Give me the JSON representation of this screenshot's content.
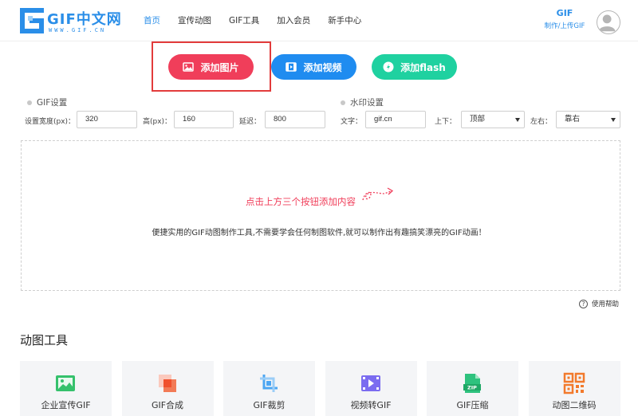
{
  "logo": {
    "title": "GIF中文网",
    "subtitle": "WWW.GIF.CN"
  },
  "nav": {
    "items": [
      {
        "label": "首页",
        "active": true
      },
      {
        "label": "宣传动图",
        "active": false
      },
      {
        "label": "GIF工具",
        "active": false
      },
      {
        "label": "加入会员",
        "active": false
      },
      {
        "label": "新手中心",
        "active": false
      }
    ]
  },
  "header_right": {
    "gif_label": "GIF",
    "gif_sub": "制作/上传GIF"
  },
  "actions": {
    "add_image": "添加图片",
    "add_video": "添加视频",
    "add_flash": "添加flash"
  },
  "gif_settings": {
    "title": "GIF设置",
    "width_label": "设置宽度(px)：",
    "width_value": "320",
    "height_label": "高(px)：",
    "height_value": "160",
    "delay_label": "延迟：",
    "delay_value": "800"
  },
  "watermark": {
    "title": "水印设置",
    "text_label": "文字：",
    "text_value": "gif.cn",
    "vertical_label": "上下：",
    "vertical_value": "顶部",
    "horizontal_label": "左右：",
    "horizontal_value": "靠右"
  },
  "drop_area": {
    "hint": "点击上方三个按钮添加内容",
    "description": "便捷实用的GIF动图制作工具,不需要学会任何制图软件,就可以制作出有趣搞笑漂亮的GIF动画！"
  },
  "help": {
    "label": "使用帮助"
  },
  "tools": {
    "title": "动图工具",
    "items": [
      {
        "label": "企业宣传GIF",
        "icon": "image-frame-icon"
      },
      {
        "label": "GIF合成",
        "icon": "layers-icon"
      },
      {
        "label": "GIF裁剪",
        "icon": "crop-icon"
      },
      {
        "label": "视频转GIF",
        "icon": "film-play-icon"
      },
      {
        "label": "GIF压缩",
        "icon": "zip-file-icon"
      },
      {
        "label": "动图二维码",
        "icon": "qr-code-icon"
      }
    ]
  },
  "colors": {
    "primary": "#2a8ee8",
    "red": "#f03e5a",
    "blue": "#1f8cf0",
    "green": "#1fd1a0"
  }
}
